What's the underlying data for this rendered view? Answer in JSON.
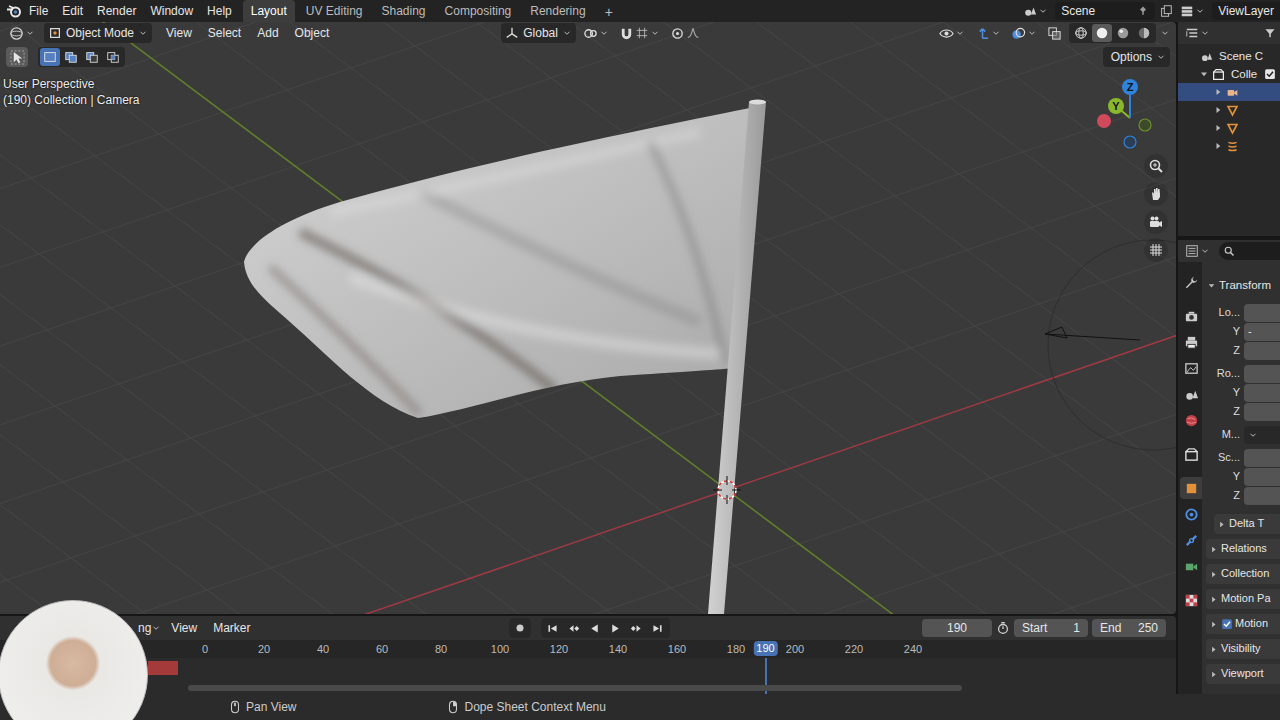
{
  "topbar": {
    "menus": [
      "File",
      "Edit",
      "Render",
      "Window",
      "Help"
    ],
    "workspaces": [
      {
        "label": "Layout",
        "selected": true
      },
      {
        "label": "UV Editing",
        "selected": false
      },
      {
        "label": "Shading",
        "selected": false
      },
      {
        "label": "Compositing",
        "selected": false
      },
      {
        "label": "Rendering",
        "selected": false
      }
    ],
    "add_workspace": "+",
    "scene": "Scene",
    "view_layer": "ViewLayer"
  },
  "viewport_header": {
    "mode": "Object Mode",
    "menus": [
      "View",
      "Select",
      "Add",
      "Object"
    ],
    "orientation": "Global",
    "shading_modes": [
      {
        "kind": "wireframe",
        "selected": false
      },
      {
        "kind": "solid",
        "selected": true
      },
      {
        "kind": "material",
        "selected": false
      },
      {
        "kind": "rendered",
        "selected": false
      }
    ]
  },
  "tool_header": {
    "tools": [
      {
        "kind": "select-box",
        "selected": true
      }
    ],
    "select_modes": [
      {
        "kind": "set",
        "selected": true
      },
      {
        "kind": "extend",
        "selected": false
      },
      {
        "kind": "subtract",
        "selected": false
      },
      {
        "kind": "intersect",
        "selected": false
      }
    ],
    "options": "Options"
  },
  "viewport": {
    "perspective": "User Perspective",
    "context": "(190) Collection | Camera"
  },
  "gizmo": {
    "axes": [
      {
        "label": "Z",
        "color": "#2f83db"
      },
      {
        "label": "Y",
        "color": "#8bb82b"
      }
    ]
  },
  "outliner": {
    "scene": "Scene C",
    "collection": {
      "label": "Colle",
      "expanded": true,
      "checked": true
    },
    "items": [
      {
        "kind": "camera",
        "selected": true,
        "expanded": false
      },
      {
        "kind": "mesh",
        "selected": false,
        "expanded": false
      },
      {
        "kind": "mesh",
        "selected": false,
        "expanded": false
      },
      {
        "kind": "force",
        "selected": false,
        "expanded": false
      }
    ]
  },
  "properties": {
    "tabs": [
      {
        "kind": "tool",
        "selected": false
      },
      {
        "kind": "render",
        "selected": false
      },
      {
        "kind": "output",
        "selected": false
      },
      {
        "kind": "view_layer",
        "selected": false
      },
      {
        "kind": "scene",
        "selected": false
      },
      {
        "kind": "world",
        "selected": false
      },
      {
        "kind": "collection",
        "selected": false
      },
      {
        "kind": "object",
        "selected": true
      },
      {
        "kind": "physics",
        "selected": false
      },
      {
        "kind": "constraints",
        "selected": false
      },
      {
        "kind": "data",
        "selected": false
      },
      {
        "kind": "texture",
        "selected": false
      }
    ],
    "panel": {
      "title": "Transform",
      "expanded": true
    },
    "rows": [
      {
        "label": "Lo...",
        "kind": "field"
      },
      {
        "label": "Y",
        "kind": "field",
        "value": "-"
      },
      {
        "label": "Z",
        "kind": "field"
      },
      {
        "label": "Ro...",
        "kind": "field"
      },
      {
        "label": "Y",
        "kind": "field"
      },
      {
        "label": "Z",
        "kind": "field"
      },
      {
        "label": "M...",
        "kind": "dropdown"
      },
      {
        "label": "Sc...",
        "kind": "field"
      },
      {
        "label": "Y",
        "kind": "field"
      },
      {
        "label": "Z",
        "kind": "field"
      }
    ],
    "sections": [
      {
        "label": "Delta T",
        "kind": "subpanel",
        "expanded": false
      },
      {
        "label": "Relations",
        "kind": "panel",
        "expanded": false
      },
      {
        "label": "Collection",
        "kind": "panel",
        "expanded": false
      },
      {
        "label": "Motion Pa",
        "kind": "panel",
        "expanded": false
      },
      {
        "label": "Motion",
        "kind": "toggle",
        "expanded": false,
        "checked": true
      },
      {
        "label": "Visibility",
        "kind": "panel",
        "expanded": false
      },
      {
        "label": "Viewport",
        "kind": "panel",
        "expanded": false
      }
    ]
  },
  "timeline": {
    "keying": "ng",
    "menus": [
      "View",
      "Marker"
    ],
    "frame": "190",
    "start_label": "Start",
    "start": "1",
    "end_label": "End",
    "end": "250",
    "ruler": [
      "0",
      "20",
      "40",
      "60",
      "80",
      "100",
      "120",
      "140",
      "160",
      "180",
      "200",
      "220",
      "240"
    ],
    "playhead": "190"
  },
  "status_bar": {
    "items": [
      {
        "label": "Pan View",
        "kind": "mouse-middle"
      },
      {
        "label": "Dope Sheet Context Menu",
        "kind": "mouse-right"
      }
    ]
  }
}
